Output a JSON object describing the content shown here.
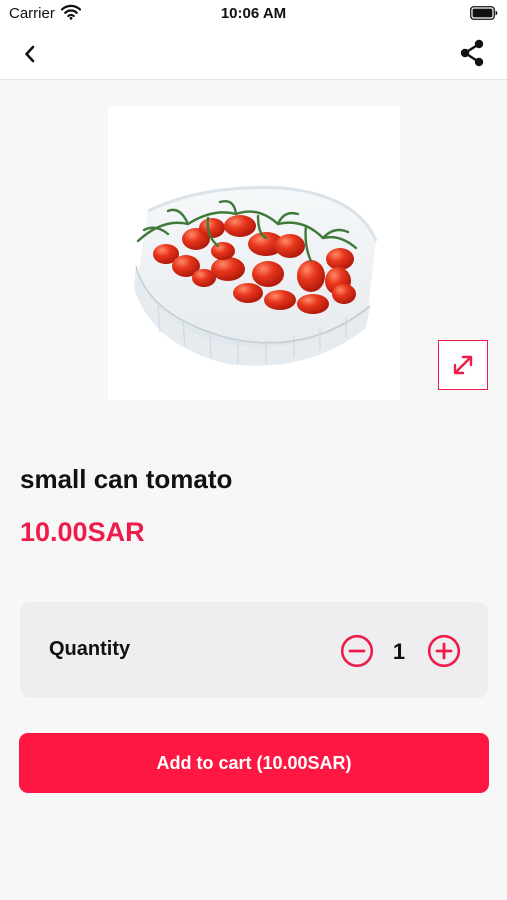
{
  "status_bar": {
    "carrier": "Carrier",
    "time": "10:06 AM",
    "icons": [
      "wifi-icon",
      "battery-icon"
    ]
  },
  "nav": {
    "icons": [
      "chevron-left-icon",
      "share-icon"
    ]
  },
  "product": {
    "image": "cherry-tomatoes-in-plastic-container",
    "title": "small can tomato",
    "price": "10.00SAR"
  },
  "quantity": {
    "label": "Quantity",
    "value": "1",
    "icons": [
      "minus-circle-icon",
      "plus-circle-icon"
    ]
  },
  "cart": {
    "button_label": "Add to cart (10.00SAR)"
  },
  "colors": {
    "accent": "#ee1c4a",
    "button": "#ff1744",
    "background": "#f7f7f7",
    "card": "#eeeef1"
  }
}
